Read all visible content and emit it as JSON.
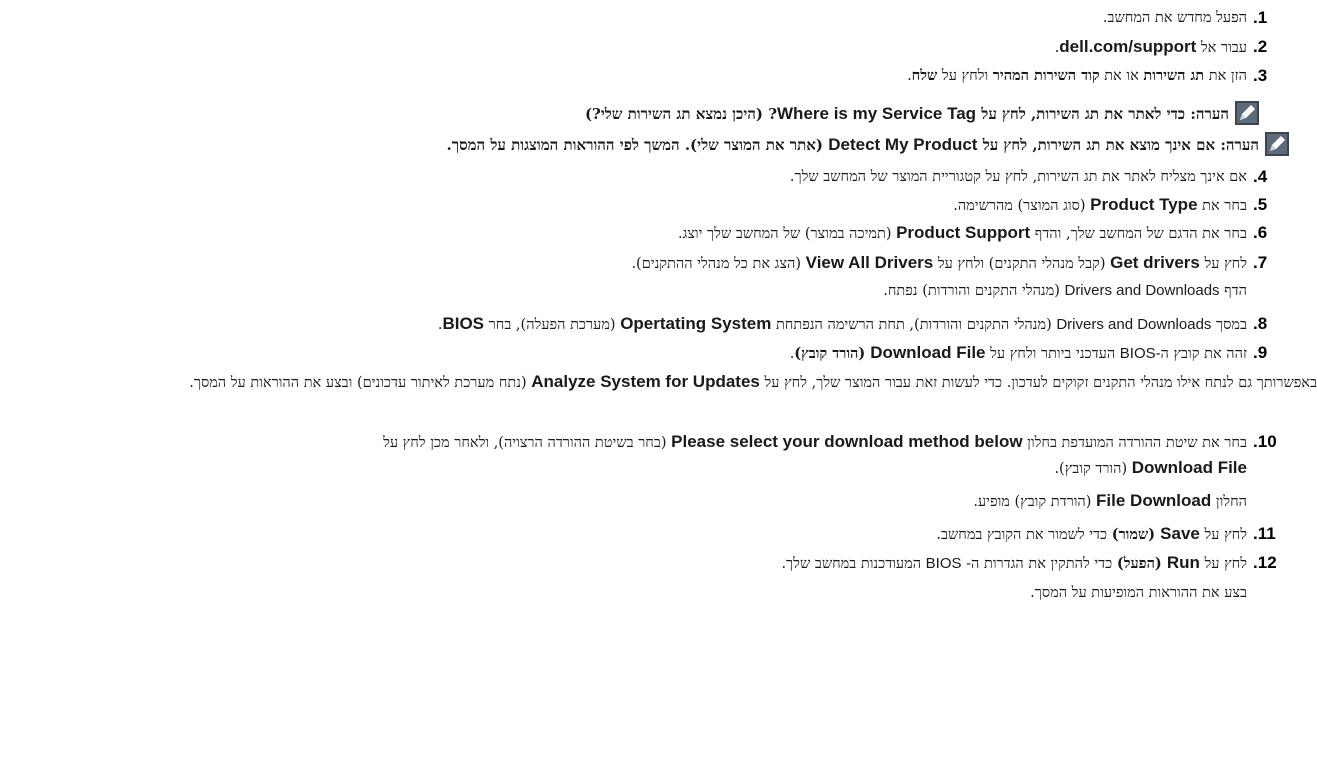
{
  "steps": [
    {
      "num": "1.",
      "segments": [
        {
          "t": "הפעל מחדש את המחשב.",
          "s": "n"
        }
      ]
    },
    {
      "num": "2.",
      "segments": [
        {
          "t": "עבור אל ",
          "s": "n"
        },
        {
          "t": "dell.com/support",
          "s": "be"
        },
        {
          "t": ".",
          "s": "n"
        }
      ]
    },
    {
      "num": "3.",
      "segments": [
        {
          "t": "הזן את ",
          "s": "n"
        },
        {
          "t": "תג השירות",
          "s": "bh"
        },
        {
          "t": " או את ",
          "s": "n"
        },
        {
          "t": "קוד השירות המהיר",
          "s": "bh"
        },
        {
          "t": " ולחץ על ",
          "s": "n"
        },
        {
          "t": "שלח",
          "s": "bh"
        },
        {
          "t": ".",
          "s": "n"
        }
      ]
    },
    {
      "num": "4.",
      "segments": [
        {
          "t": "אם אינך מצליח לאתר את תג השירות, לחץ על קטגוריית המוצר של המחשב שלך.",
          "s": "n"
        }
      ]
    },
    {
      "num": "5.",
      "segments": [
        {
          "t": "בחר את ",
          "s": "n"
        },
        {
          "t": "Product Type",
          "s": "be"
        },
        {
          "t": " (סוג המוצר) מהרשימה.",
          "s": "n"
        }
      ]
    },
    {
      "num": "6.",
      "segments": [
        {
          "t": "בחר את הדגם של המחשב שלך, והדף ",
          "s": "n"
        },
        {
          "t": "Product Support",
          "s": "be"
        },
        {
          "t": " (תמיכה במוצר) של המחשב שלך יוצג.",
          "s": "n"
        }
      ]
    },
    {
      "num": "7.",
      "segments": [
        {
          "t": "לחץ על ",
          "s": "n"
        },
        {
          "t": "Get drivers",
          "s": "be"
        },
        {
          "t": " (קבל מנהלי התקנים) ולחץ על ",
          "s": "n"
        },
        {
          "t": "View All Drivers",
          "s": "be"
        },
        {
          "t": " (הצג את כל מנהלי ההתקנים).",
          "s": "n"
        }
      ]
    },
    {
      "num": "8.",
      "segments": [
        {
          "t": "במסך ",
          "s": "n"
        },
        {
          "t": "Drivers and Downloads",
          "s": "ne"
        },
        {
          "t": " (מנהלי התקנים והורדות), תחת הרשימה הנפתחת ",
          "s": "n"
        },
        {
          "t": "Opertating System",
          "s": "be"
        },
        {
          "t": " (מערכת הפעלה), בחר ",
          "s": "n"
        },
        {
          "t": "BIOS",
          "s": "be"
        },
        {
          "t": ".",
          "s": "n"
        }
      ]
    },
    {
      "num": "9.",
      "segments": [
        {
          "t": "זהה את קובץ ה-",
          "s": "n"
        },
        {
          "t": "BIOS",
          "s": "ne"
        },
        {
          "t": " העדכני ביותר ולחץ על ",
          "s": "n"
        },
        {
          "t": "Download File",
          "s": "be"
        },
        {
          "t": " (הורד קובץ)",
          "s": "bh"
        },
        {
          "t": ".",
          "s": "n"
        }
      ]
    },
    {
      "num": "10.",
      "segments": [
        {
          "t": "בחר את שיטת ההורדה המועדפת בחלון ",
          "s": "n"
        },
        {
          "t": "Please select your download method below",
          "s": "be"
        },
        {
          "t": " (בחר בשיטת ההורדה הרצויה), ולאחר מכן לחץ על",
          "s": "n"
        }
      ]
    },
    {
      "num": "11.",
      "segments": [
        {
          "t": "לחץ על ",
          "s": "n"
        },
        {
          "t": "Save",
          "s": "be"
        },
        {
          "t": " (שמור)",
          "s": "bh"
        },
        {
          "t": " כדי לשמור את הקובץ במחשב.",
          "s": "n"
        }
      ]
    },
    {
      "num": "12.",
      "segments": [
        {
          "t": "לחץ על ",
          "s": "n"
        },
        {
          "t": "Run",
          "s": "be"
        },
        {
          "t": " (הפעל)",
          "s": "bh"
        },
        {
          "t": " כדי להתקין את הגדרות ה- ",
          "s": "n"
        },
        {
          "t": "BIOS",
          "s": "ne"
        },
        {
          "t": " המעודכנות במחשב שלך.",
          "s": "n"
        }
      ]
    }
  ],
  "notes": [
    {
      "segments": [
        {
          "t": "הערה: כדי לאתר את תג השירות, לחץ על ",
          "s": "bh"
        },
        {
          "t": "Where is my Service Tag",
          "s": "be"
        },
        {
          "t": "? (היכן נמצא תג השירות שלי?)",
          "s": "bh"
        }
      ]
    },
    {
      "segments": [
        {
          "t": "הערה: אם אינך מוצא את תג השירות, לחץ על ",
          "s": "bh"
        },
        {
          "t": "Detect My Product",
          "s": "be"
        },
        {
          "t": " (אתר את המוצר שלי). המשך לפי ההוראות המוצגות על המסך.",
          "s": "bh"
        }
      ]
    }
  ],
  "sub_lines": [
    {
      "segments": [
        {
          "t": "הדף ",
          "s": "n"
        },
        {
          "t": "Drivers and Downloads",
          "s": "ne"
        },
        {
          "t": " (מנהלי התקנים והורדות) נפתח.",
          "s": "n"
        }
      ]
    },
    {
      "segments": [
        {
          "t": "Download File",
          "s": "be"
        },
        {
          "t": " (הורד קובץ).",
          "s": "n"
        }
      ]
    },
    {
      "segments": [
        {
          "t": "החלון ",
          "s": "n"
        },
        {
          "t": "File Download",
          "s": "be"
        },
        {
          "t": " (הורדת קובץ) מופיע.",
          "s": "n"
        }
      ]
    },
    {
      "segments": [
        {
          "t": "בצע את ההוראות המופיעות על המסך.",
          "s": "n"
        }
      ]
    }
  ],
  "paragraph": {
    "segments": [
      {
        "t": "באפשרותך גם לנתח אילו מנהלי התקנים זקוקים לעדכון. כדי לעשות זאת עבור המוצר שלך, לחץ על ",
        "s": "n"
      },
      {
        "t": "Analyze System for Updates",
        "s": "be"
      },
      {
        "t": " (נתח מערכת לאיתור עדכונים) ובצע את ההוראות על המסך.",
        "s": "n"
      }
    ]
  },
  "icons": {
    "note": "note-pencil-icon"
  }
}
